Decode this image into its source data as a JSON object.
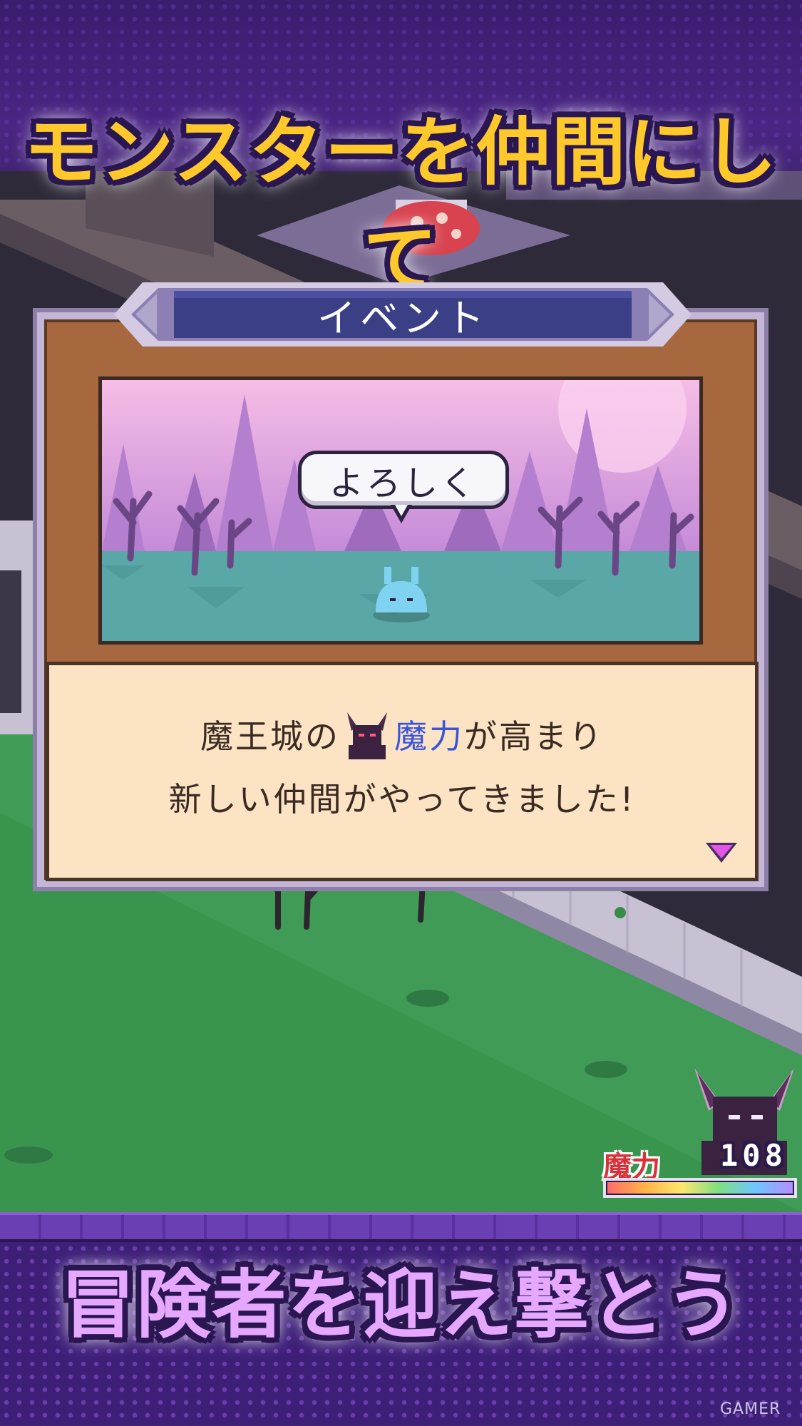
{
  "headline_top": "モンスターを仲間にして",
  "headline_bottom": "冒険者を迎え撃とう",
  "event": {
    "title": "イベント",
    "speech": "よろしく",
    "message_line1_prefix": "魔王城の",
    "message_line1_highlight": "魔力",
    "message_line1_suffix": "が高まり",
    "message_line2": "新しい仲間がやってきました!",
    "continue_icon": "triangle-down-icon"
  },
  "hud": {
    "magic_label": "魔力",
    "magic_value": "108",
    "magic_fill": 1.0,
    "portrait_icon": "demon-lord-icon"
  },
  "watermark": "GAMER",
  "colors": {
    "headline_top": "#ffc92c",
    "headline_bottom": "#e6a8ff",
    "highlight": "#3a55d9",
    "magic_label": "#d8323a"
  }
}
